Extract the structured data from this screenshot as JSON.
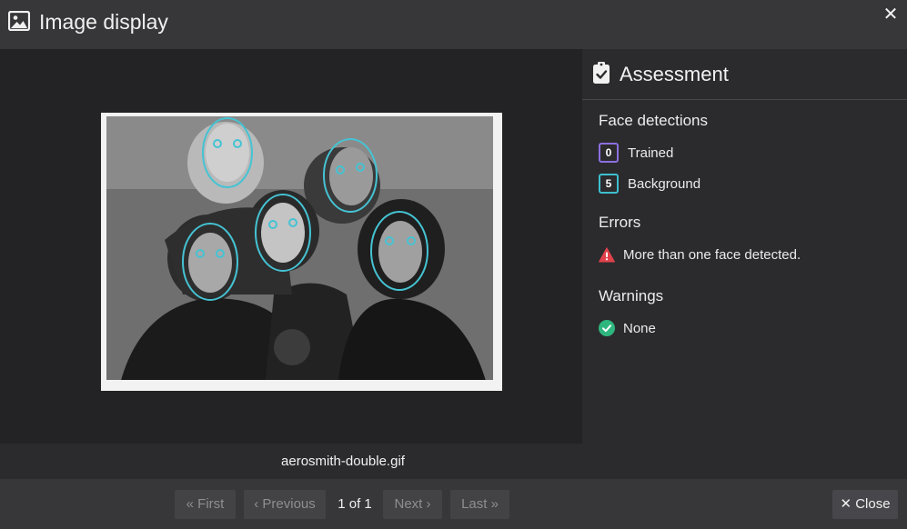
{
  "window": {
    "title": "Image display",
    "title_icon": "image-icon",
    "close_icon": "close-icon",
    "close_glyph": "✕"
  },
  "image": {
    "filename": "aerosmith-double.gif",
    "face_marker_color": "#45c3d3"
  },
  "assessment": {
    "icon": "clipboard-check-icon",
    "title": "Assessment",
    "face_detections": {
      "title": "Face detections",
      "trained": {
        "count": "0",
        "label": "Trained",
        "color": "#8c6fe0"
      },
      "background": {
        "count": "5",
        "label": "Background",
        "color": "#3ebfcf"
      }
    },
    "errors": {
      "title": "Errors",
      "items": [
        {
          "icon": "warning-triangle-icon",
          "text": "More than one face detected.",
          "color": "#e0424b"
        }
      ]
    },
    "warnings": {
      "title": "Warnings",
      "items": [
        {
          "icon": "check-circle-icon",
          "text": "None",
          "color": "#2fb67f"
        }
      ]
    }
  },
  "footer": {
    "first_label": "« First",
    "previous_label": "‹ Previous",
    "page_indicator": "1 of 1",
    "next_label": "Next ›",
    "last_label": "Last »",
    "close_label": "✕ Close"
  }
}
